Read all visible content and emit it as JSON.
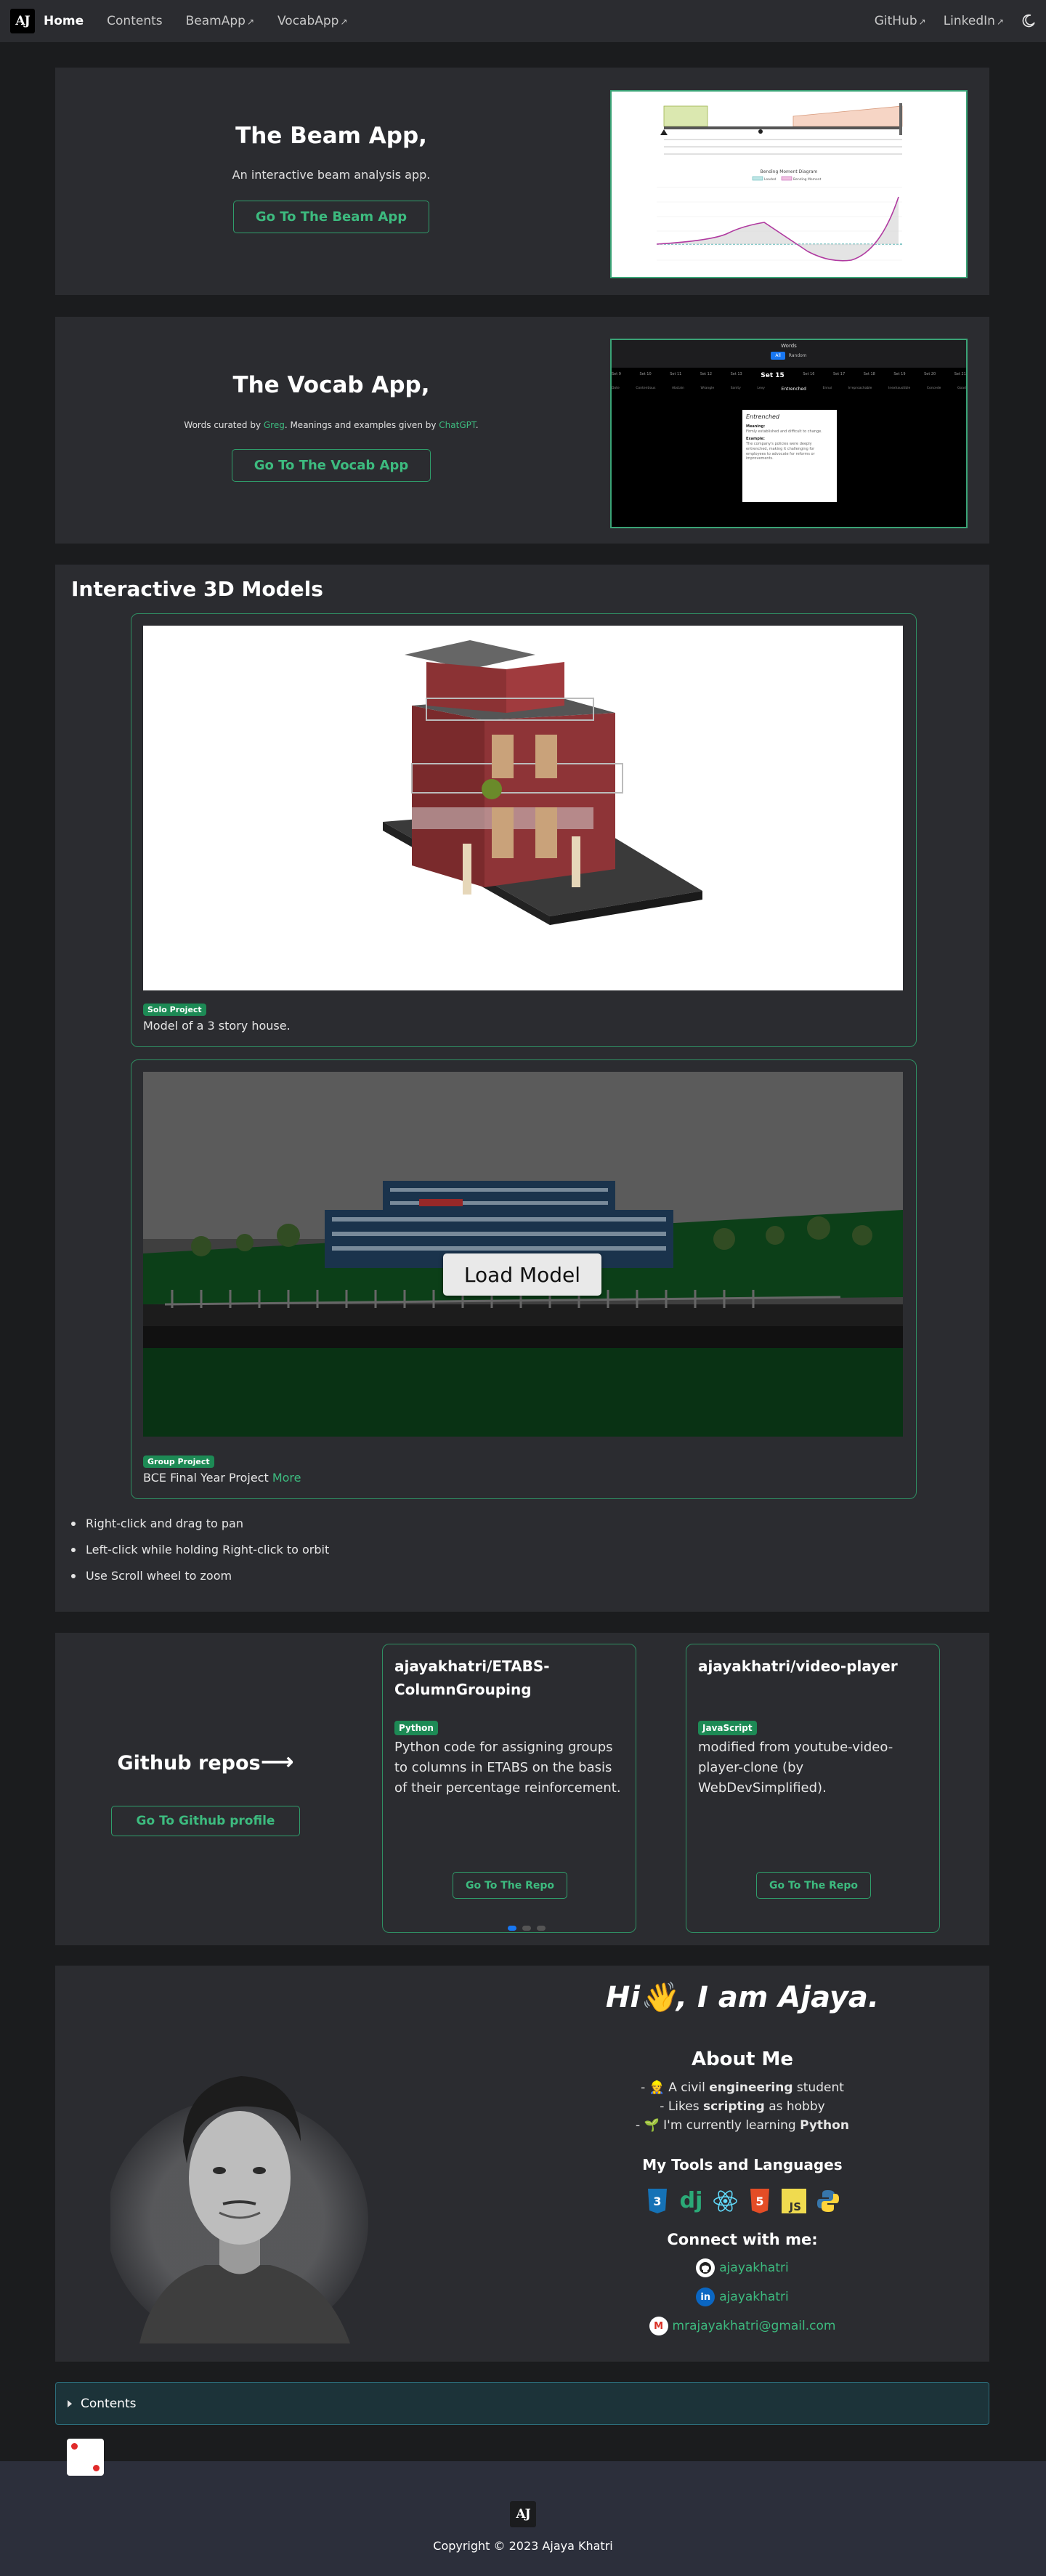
{
  "nav": {
    "logo": "AJ",
    "links": [
      "Home",
      "Contents",
      "BeamApp",
      "VocabApp"
    ],
    "right_links": [
      "GitHub",
      "LinkedIn"
    ],
    "ext_icon": "↗",
    "theme_icon": "moon-icon"
  },
  "beam": {
    "title": "The Beam App,",
    "subtitle": "An interactive beam analysis app.",
    "button": "Go To The Beam App",
    "chart_title": "Bending Moment Diagram",
    "legend": [
      "Loaded",
      "Bending Moment"
    ]
  },
  "vocab": {
    "title": "The Vocab App,",
    "sub_pre": "Words curated by ",
    "sub_greg": "Greg",
    "sub_mid": ". Meanings and examples given by ",
    "sub_gpt": "ChatGPT",
    "sub_post": ".",
    "button": "Go To The Vocab App",
    "app_title": "Words",
    "toggle_all": "All",
    "toggle_random": "Random",
    "sets": [
      "Set 9",
      "Set 10",
      "Set 11",
      "Set 12",
      "Set 13",
      "Set 15",
      "Set 16",
      "Set 17",
      "Set 18",
      "Set 19",
      "Set 20",
      "Set 21"
    ],
    "active_set": "Set 15",
    "words": [
      "Dote",
      "Contentious",
      "Abstain",
      "Wrangle",
      "Sanity",
      "Levy",
      "Entrenched",
      "Ennui",
      "Irreproachable",
      "Inexhaustible",
      "Concede",
      "Goad"
    ],
    "popup": {
      "word": "Entrenched",
      "meaning_label": "Meaning:",
      "meaning": "Firmly established and difficult to change.",
      "example_label": "Example:",
      "example": "The company's policies were deeply entrenched, making it challenging for employees to advocate for reforms or improvements."
    }
  },
  "models": {
    "title": "Interactive 3D Models",
    "cards": [
      {
        "badge": "Solo Project",
        "desc": "Model of a 3 story house.",
        "more": ""
      },
      {
        "badge": "Group Project",
        "desc": "BCE Final Year Project ",
        "more": "More",
        "load": "Load Model"
      }
    ],
    "tips": [
      "Right-click and drag to pan",
      "Left-click while holding Right-click to orbit",
      "Use Scroll wheel to zoom"
    ]
  },
  "github": {
    "title": "Github repos",
    "arrow": "⟶",
    "button": "Go To Github profile",
    "repos": [
      {
        "name": "ajayakhatri/ETABS-ColumnGrouping",
        "lang": "Python",
        "desc": "Python code for assigning groups to columns in ETABS on the basis of their percentage reinforcement.",
        "button": "Go To The Repo"
      },
      {
        "name": "ajayakhatri/video-player",
        "lang": "JavaScript",
        "desc": "modified from youtube-video-player-clone (by WebDevSimplified).",
        "button": "Go To The Repo"
      }
    ]
  },
  "about": {
    "hi": "Hi👋, I am Ajaya.",
    "heading": "About Me",
    "line1_pre": "- 👷 A civil ",
    "line1_bold": "engineering",
    "line1_post": " student",
    "line2_pre": "- Likes ",
    "line2_bold": "scripting",
    "line2_post": " as hobby",
    "line3_pre": "- 🌱 I'm currently learning ",
    "line3_bold": "Python",
    "tools_heading": "My Tools and Languages",
    "tools": [
      "css3-icon",
      "django-icon",
      "react-icon",
      "html5-icon",
      "javascript-icon",
      "python-icon"
    ],
    "connect_heading": "Connect with me:",
    "github_user": "ajayakhatri",
    "linkedin_user": "ajayakhatri",
    "email": "mrajayakhatri@gmail.com"
  },
  "contents": {
    "label": "Contents"
  },
  "footer": {
    "logo": "AJ",
    "copyright": "Copyright © 2023 Ajaya Khatri"
  },
  "colors": {
    "accent": "#3dbb7f",
    "card": "#2b2c30",
    "bg": "#1b1c1e",
    "link_blue": "#1877f2"
  }
}
